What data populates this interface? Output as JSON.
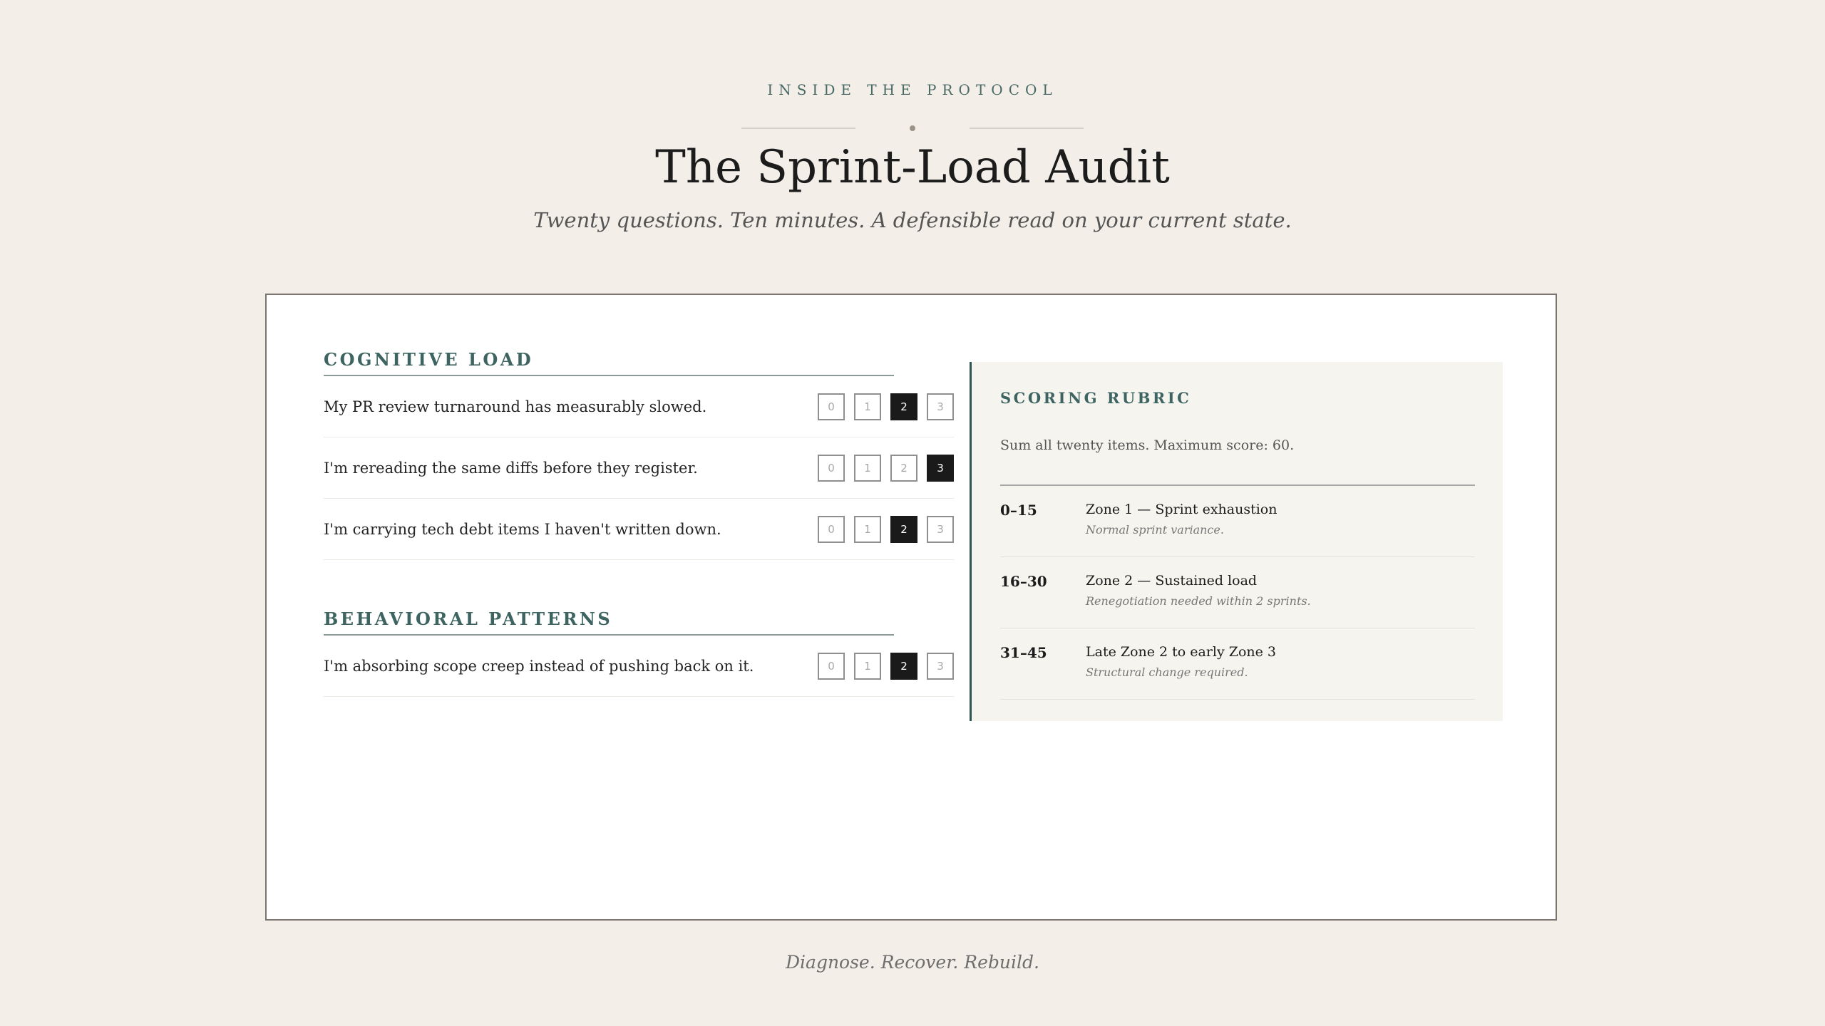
{
  "header": {
    "eyebrow": "INSIDE THE PROTOCOL",
    "title": "The Sprint-Load Audit",
    "subtitle": "Twenty questions. Ten minutes. A defensible read on your current state."
  },
  "sections": [
    {
      "title": "COGNITIVE LOAD",
      "questions": [
        {
          "text": "My PR review turnaround has measurably slowed.",
          "options": [
            "0",
            "1",
            "2",
            "3"
          ],
          "selected": 2
        },
        {
          "text": "I'm rereading the same diffs before they register.",
          "options": [
            "0",
            "1",
            "2",
            "3"
          ],
          "selected": 3
        },
        {
          "text": "I'm carrying tech debt items I haven't written down.",
          "options": [
            "0",
            "1",
            "2",
            "3"
          ],
          "selected": 2
        }
      ]
    },
    {
      "title": "BEHAVIORAL PATTERNS",
      "questions": [
        {
          "text": "I'm absorbing scope creep instead of pushing back on it.",
          "options": [
            "0",
            "1",
            "2",
            "3"
          ],
          "selected": 2
        }
      ]
    }
  ],
  "rubric": {
    "title": "SCORING RUBRIC",
    "note": "Sum all twenty items. Maximum score: 60.",
    "zones": [
      {
        "range": "0–15",
        "name": "Zone 1 — Sprint exhaustion",
        "desc": "Normal sprint variance."
      },
      {
        "range": "16–30",
        "name": "Zone 2 — Sustained load",
        "desc": "Renegotiation needed within 2 sprints."
      },
      {
        "range": "31–45",
        "name": "Late Zone 2 to early Zone 3",
        "desc": "Structural change required."
      }
    ]
  },
  "footer": {
    "tagline": "Diagnose. Recover. Rebuild."
  },
  "colors": {
    "accent": "#3e6461",
    "background": "#f3efe8",
    "selected": "#1a1a1a"
  }
}
